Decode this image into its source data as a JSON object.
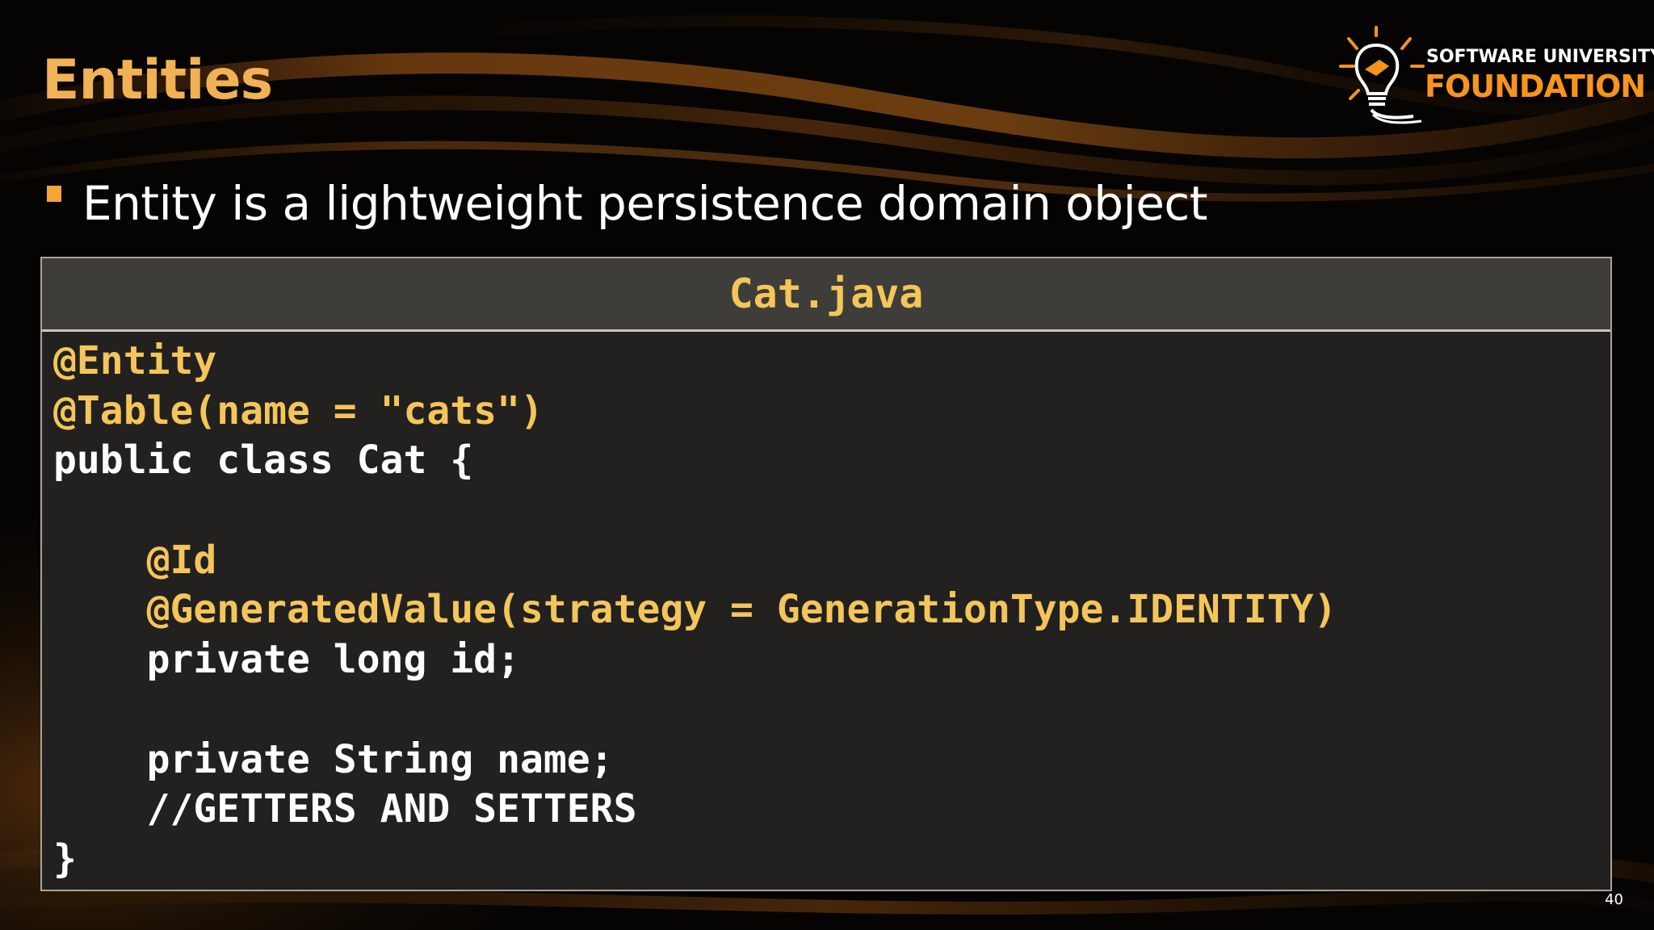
{
  "slide": {
    "title": "Entities",
    "bullets": [
      "Entity is a lightweight persistence domain object"
    ],
    "page_number": "40"
  },
  "logo": {
    "line1": "SOFTWARE UNIVERSITY",
    "line2": "FOUNDATION",
    "icon": "lightbulb-icon"
  },
  "code_block": {
    "filename": "Cat.java",
    "lines": [
      {
        "indent": "",
        "tokens": [
          {
            "text": "@Entity",
            "kind": "annotation"
          }
        ]
      },
      {
        "indent": "",
        "tokens": [
          {
            "text": "@Table(name = \"cats\")",
            "kind": "annotation"
          }
        ]
      },
      {
        "indent": "",
        "tokens": [
          {
            "text": "public class Cat {",
            "kind": "plain"
          }
        ]
      },
      {
        "indent": "",
        "tokens": []
      },
      {
        "indent": "    ",
        "tokens": [
          {
            "text": "@Id",
            "kind": "annotation"
          }
        ]
      },
      {
        "indent": "    ",
        "tokens": [
          {
            "text": "@GeneratedValue(strategy = GenerationType.IDENTITY)",
            "kind": "annotation"
          }
        ]
      },
      {
        "indent": "    ",
        "tokens": [
          {
            "text": "private long id;",
            "kind": "plain"
          }
        ]
      },
      {
        "indent": "",
        "tokens": []
      },
      {
        "indent": "    ",
        "tokens": [
          {
            "text": "private String name;",
            "kind": "plain"
          }
        ]
      },
      {
        "indent": "    ",
        "tokens": [
          {
            "text": "//GETTERS AND SETTERS",
            "kind": "plain"
          }
        ]
      },
      {
        "indent": "",
        "tokens": [
          {
            "text": "}",
            "kind": "plain"
          }
        ]
      }
    ]
  },
  "colors": {
    "title": "#f1b255",
    "annotation": "#f4c55a",
    "bullet_marker": "#f3a43b",
    "logo_accent": "#f7941d",
    "code_background": "#222120",
    "code_header_background": "#3f3d39"
  }
}
